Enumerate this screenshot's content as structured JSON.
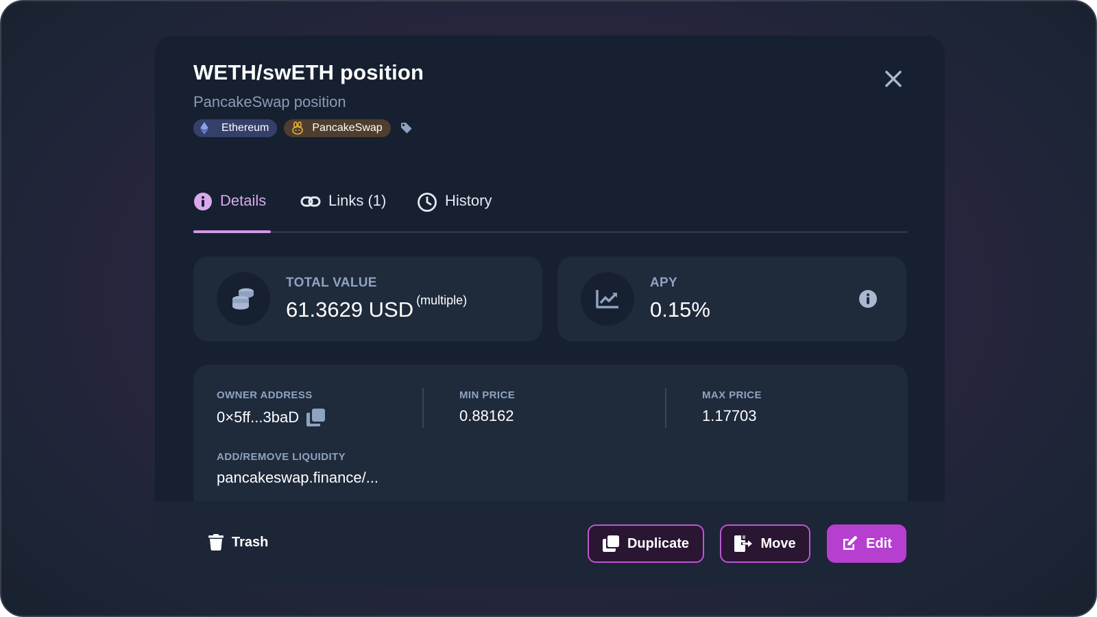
{
  "header": {
    "title": "WETH/swETH position",
    "subtitle": "PancakeSwap position"
  },
  "tags": [
    {
      "label": "Ethereum",
      "icon": "ethereum-icon"
    },
    {
      "label": "PancakeSwap",
      "icon": "pancakeswap-icon"
    }
  ],
  "tabs": [
    {
      "label": "Details",
      "icon": "info-icon",
      "active": true
    },
    {
      "label": "Links (1)",
      "icon": "link-icon",
      "active": false
    },
    {
      "label": "History",
      "icon": "clock-icon",
      "active": false
    }
  ],
  "stats": {
    "total_value": {
      "label": "TOTAL VALUE",
      "value": "61.3629 USD",
      "suffix": "(multiple)",
      "icon": "coins-icon"
    },
    "apy": {
      "label": "APY",
      "value": "0.15%",
      "icon": "chart-line-icon"
    }
  },
  "details": {
    "owner_address": {
      "label": "OWNER ADDRESS",
      "value": "0×5ff...3baD"
    },
    "min_price": {
      "label": "MIN PRICE",
      "value": "0.88162"
    },
    "max_price": {
      "label": "MAX PRICE",
      "value": "1.17703"
    },
    "liquidity": {
      "label": "ADD/REMOVE LIQUIDITY",
      "value": "pancakeswap.finance/..."
    }
  },
  "footer": {
    "trash_label": "Trash",
    "duplicate_label": "Duplicate",
    "move_label": "Move",
    "edit_label": "Edit"
  },
  "colors": {
    "accent": "#b73fd0",
    "accent_tab": "#dca8ec",
    "modal_bg": "#162030",
    "card_bg": "#1f2a3b",
    "muted_text": "#8fa3c1"
  }
}
